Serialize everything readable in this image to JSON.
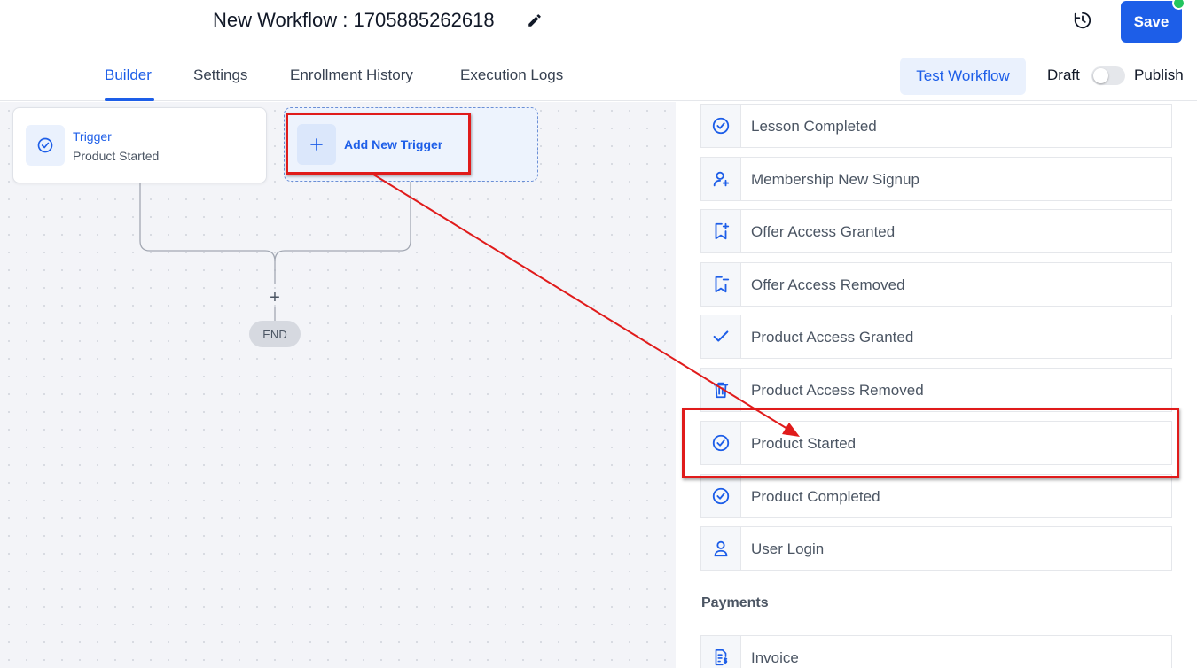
{
  "header": {
    "title": "New Workflow : 1705885262618",
    "save_label": "Save"
  },
  "tabs": [
    {
      "label": "Builder",
      "active": true
    },
    {
      "label": "Settings",
      "active": false
    },
    {
      "label": "Enrollment History",
      "active": false
    },
    {
      "label": "Execution Logs",
      "active": false
    }
  ],
  "toolbar": {
    "test_label": "Test Workflow",
    "draft_label": "Draft",
    "publish_label": "Publish",
    "published": false
  },
  "canvas": {
    "trigger_node": {
      "title": "Trigger",
      "subtitle": "Product Started",
      "icon": "check-circle-icon"
    },
    "add_trigger_label": "Add New Trigger",
    "end_label": "END",
    "plus_symbol": "+"
  },
  "panel": {
    "items": [
      {
        "label": "Lesson Completed",
        "icon": "check-circle-icon"
      },
      {
        "label": "Membership New Signup",
        "icon": "user-plus-icon"
      },
      {
        "label": "Offer Access Granted",
        "icon": "bookmark-plus-icon"
      },
      {
        "label": "Offer Access Removed",
        "icon": "bookmark-minus-icon"
      },
      {
        "label": "Product Access Granted",
        "icon": "checkmark-icon"
      },
      {
        "label": "Product Access Removed",
        "icon": "trash-icon"
      },
      {
        "label": "Product Started",
        "icon": "check-circle-icon"
      },
      {
        "label": "Product Completed",
        "icon": "check-circle-icon"
      },
      {
        "label": "User Login",
        "icon": "user-icon"
      }
    ],
    "section_payments": "Payments",
    "payments_items": [
      {
        "label": "Invoice",
        "icon": "invoice-icon"
      }
    ]
  },
  "colors": {
    "accent": "#1d5ee8",
    "annotation": "#e01b1b",
    "status_dot": "#22c55e"
  }
}
